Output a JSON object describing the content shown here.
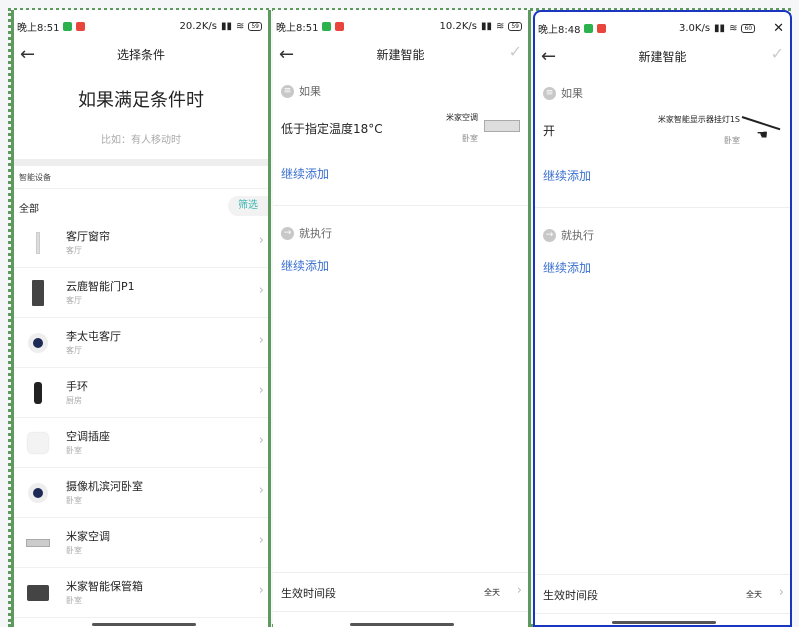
{
  "panels": [
    {
      "status": {
        "time": "晚上8:51",
        "speed": "20.2K/s",
        "battery": "59"
      },
      "title": "选择条件",
      "heading": "如果满足条件时",
      "hint": "比如：有人移动时",
      "section": "智能设备",
      "all": "全部",
      "filter": "筛选",
      "devices": [
        {
          "name": "客厅窗帘",
          "room": "客厅",
          "icon": "curtain-icon"
        },
        {
          "name": "云鹿智能门P1",
          "room": "客厅",
          "icon": "door-icon"
        },
        {
          "name": "李太屯客厅",
          "room": "客厅",
          "icon": "camera-icon"
        },
        {
          "name": "手环",
          "room": "厨房",
          "icon": "band-icon"
        },
        {
          "name": "空调插座",
          "room": "卧室",
          "icon": "socket-icon"
        },
        {
          "name": "摄像机滨河卧室",
          "room": "卧室",
          "icon": "camera-icon"
        },
        {
          "name": "米家空调",
          "room": "卧室",
          "icon": "ac-icon"
        },
        {
          "name": "米家智能保管箱",
          "room": "卧室",
          "icon": "safe-box-icon"
        }
      ]
    },
    {
      "status": {
        "time": "晚上8:51",
        "speed": "10.2K/s",
        "battery": "59"
      },
      "title": "新建智能",
      "if_label": "如果",
      "condition": "低于指定温度18°C",
      "cond_device": "米家空调",
      "cond_room": "卧室",
      "add_more": "继续添加",
      "then_label": "就执行",
      "add_more2": "继续添加",
      "period_label": "生效时间段",
      "period_value": "全天"
    },
    {
      "status": {
        "time": "晚上8:48",
        "speed": "3.0K/s",
        "battery": "60"
      },
      "close": "✕",
      "title": "新建智能",
      "if_label": "如果",
      "condition": "开",
      "cond_device": "米家智能显示器挂灯1S",
      "cond_room": "卧室",
      "add_more": "继续添加",
      "then_label": "就执行",
      "add_more2": "继续添加",
      "period_label": "生效时间段",
      "period_value": "全天"
    }
  ]
}
